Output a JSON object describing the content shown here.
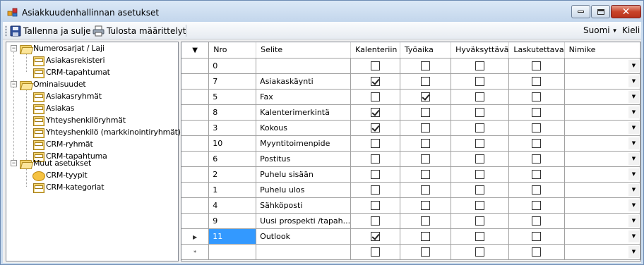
{
  "window": {
    "title": "Asiakkuudenhallinnan asetukset"
  },
  "toolbar": {
    "save_label": "Tallenna ja sulje",
    "print_label": "Tulosta määrittelyt",
    "language_label": "Suomi",
    "kieli_label": "Kieli"
  },
  "tree": {
    "nodes": [
      {
        "label": "Numerosarjat / Laji"
      },
      {
        "label": "Asiakasrekisteri"
      },
      {
        "label": "CRM-tapahtumat"
      },
      {
        "label": "Ominaisuudet"
      },
      {
        "label": "Asiakasryhmät"
      },
      {
        "label": "Asiakas"
      },
      {
        "label": "Yhteyshenkilöryhmät"
      },
      {
        "label": "Yhteyshenkilö (markkinointiryhmät)"
      },
      {
        "label": "CRM-ryhmät"
      },
      {
        "label": "CRM-tapahtuma"
      },
      {
        "label": "Muut asetukset"
      },
      {
        "label": "CRM-tyypit"
      },
      {
        "label": "CRM-kategoriat"
      }
    ]
  },
  "grid": {
    "columns": [
      "Nro",
      "Selite",
      "Kalenteriin",
      "Työaika",
      "Hyväksyttävä",
      "Laskutettava",
      "Nimike"
    ],
    "rows": [
      {
        "nro": "0",
        "selite": "",
        "kal": false,
        "tyo": false,
        "hyv": false,
        "lask": false
      },
      {
        "nro": "7",
        "selite": "Asiakaskäynti",
        "kal": true,
        "tyo": false,
        "hyv": false,
        "lask": false
      },
      {
        "nro": "5",
        "selite": "Fax",
        "kal": false,
        "tyo": true,
        "hyv": false,
        "lask": false
      },
      {
        "nro": "8",
        "selite": "Kalenterimerkintä",
        "kal": true,
        "tyo": false,
        "hyv": false,
        "lask": false
      },
      {
        "nro": "3",
        "selite": "Kokous",
        "kal": true,
        "tyo": false,
        "hyv": false,
        "lask": false
      },
      {
        "nro": "10",
        "selite": "Myyntitoimenpide",
        "kal": false,
        "tyo": false,
        "hyv": false,
        "lask": false
      },
      {
        "nro": "6",
        "selite": "Postitus",
        "kal": false,
        "tyo": false,
        "hyv": false,
        "lask": false
      },
      {
        "nro": "2",
        "selite": "Puhelu sisään",
        "kal": false,
        "tyo": false,
        "hyv": false,
        "lask": false
      },
      {
        "nro": "1",
        "selite": "Puhelu ulos",
        "kal": false,
        "tyo": false,
        "hyv": false,
        "lask": false
      },
      {
        "nro": "4",
        "selite": "Sähköposti",
        "kal": false,
        "tyo": false,
        "hyv": false,
        "lask": false
      },
      {
        "nro": "9",
        "selite": "Uusi prospekti /tapah...",
        "kal": false,
        "tyo": false,
        "hyv": false,
        "lask": false
      },
      {
        "nro": "11",
        "selite": "Outlook",
        "kal": true,
        "tyo": false,
        "hyv": false,
        "lask": false,
        "selected": true
      },
      {
        "nro": "",
        "selite": "",
        "kal": false,
        "tyo": false,
        "hyv": false,
        "lask": false,
        "new_row": true
      }
    ],
    "new_row_marker": "*"
  }
}
